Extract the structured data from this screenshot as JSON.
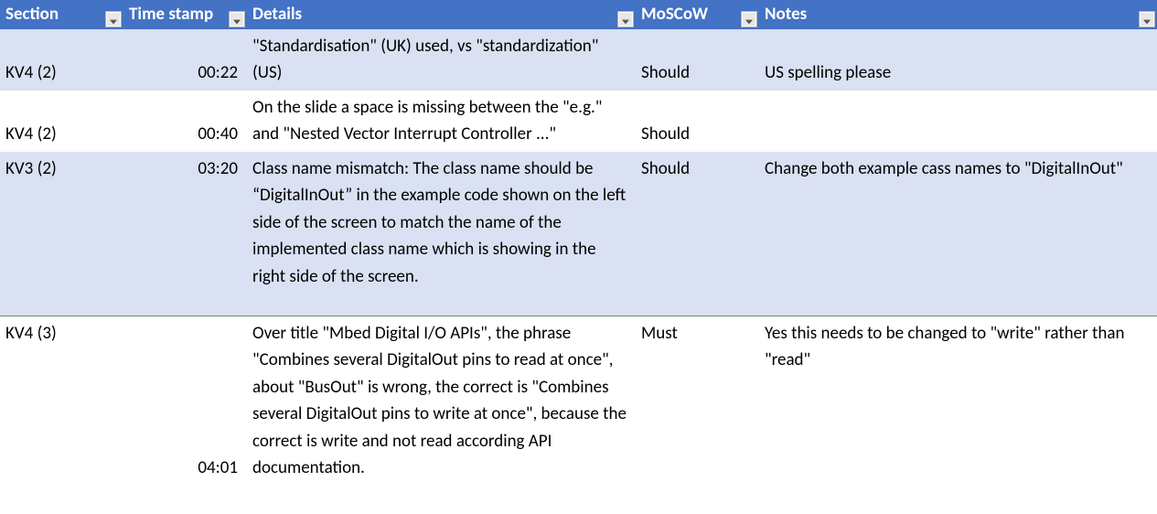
{
  "columns": {
    "section": "Section",
    "timestamp": "Time stamp",
    "details": "Details",
    "moscow": "MoSCoW",
    "notes": "Notes"
  },
  "rows": [
    {
      "section": "KV4 (2)",
      "timestamp": "00:22",
      "details": "\"Standardisation\" (UK) used, vs \"standardization\" (US)",
      "moscow": "Should",
      "notes": "US spelling please"
    },
    {
      "section": "KV4 (2)",
      "timestamp": "00:40",
      "details": "On the slide a space is missing between the \"e.g.\" and \"Nested Vector Interrupt Controller ...\"",
      "moscow": "Should",
      "notes": ""
    },
    {
      "section": "KV3 (2)",
      "timestamp": "03:20",
      "details": "Class name mismatch: The class name should be “DigitalInOut” in the example code shown on the left side of the screen to match the name of the implemented class name which is showing in the right side of the screen.",
      "moscow": "Should",
      "notes": "Change both example cass names to \"DigitalInOut\""
    },
    {
      "section": "KV4 (3)",
      "timestamp": "04:01",
      "details": "Over title \"Mbed Digital I/O APIs\", the phrase \"Combines several DigitalOut pins to read at once\", about \"BusOut\" is wrong, the correct is \"Combines several DigitalOut pins to write at once\", because the correct is write and not read according API documentation.",
      "moscow": "Must",
      "notes": "Yes this needs to be changed to \"write\" rather than \"read\""
    }
  ]
}
